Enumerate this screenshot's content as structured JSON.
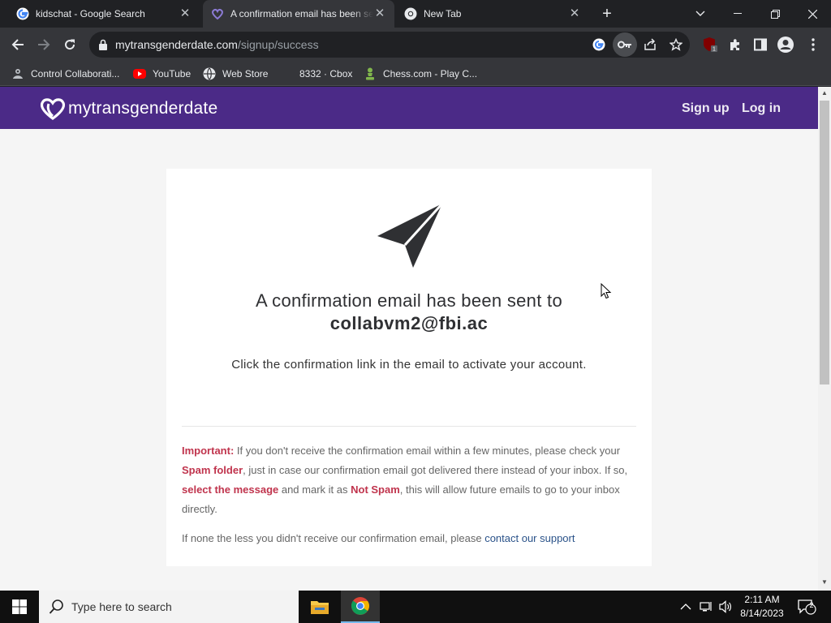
{
  "tabs": [
    {
      "title": "kidschat - Google Search",
      "favicon": "google-icon",
      "active": false
    },
    {
      "title": "A confirmation email has been sent",
      "favicon": "site-heart-icon",
      "active": true
    },
    {
      "title": "New Tab",
      "favicon": "chrome-icon",
      "active": false
    }
  ],
  "toolbar": {
    "url_host": "mytransgenderdate.com",
    "url_path": "/signup/success"
  },
  "bookmarks": [
    {
      "label": "Control Collaborati...",
      "icon": "collabvm-icon"
    },
    {
      "label": "YouTube",
      "icon": "youtube-icon"
    },
    {
      "label": "Web Store",
      "icon": "web-store-icon"
    },
    {
      "label": "8332 · Cbox",
      "icon": "cbox-icon"
    },
    {
      "label": "Chess.com - Play C...",
      "icon": "chess-pawn-icon"
    }
  ],
  "site": {
    "brand": "mytransgenderdate",
    "nav": {
      "signup": "Sign up",
      "login": "Log in"
    },
    "colors": {
      "header": "#4b2a87",
      "highlight": "#c0344d",
      "link": "#2a5289"
    }
  },
  "confirmation": {
    "headline": "A confirmation email has been sent to",
    "email": "collabvm2@fbi.ac",
    "subline": "Click the confirmation link in the email to activate your account.",
    "important_label": "Important:",
    "important_text_1": " If you don't receive the confirmation email within a few minutes, please check your ",
    "spam_folder": "Spam folder",
    "important_text_2": ", just in case our confirmation email got delivered there instead of your inbox. If so, ",
    "select_message": "select the message",
    "important_text_3": " and mark it as ",
    "not_spam": "Not Spam",
    "important_text_4": ", this will allow future emails to go to your inbox directly.",
    "fallback_text": "If none the less you didn't receive our confirmation email, please ",
    "support_link": "contact our support"
  },
  "taskbar": {
    "search_placeholder": "Type here to search",
    "time": "2:11 AM",
    "date": "8/14/2023",
    "notification_count": "2"
  }
}
